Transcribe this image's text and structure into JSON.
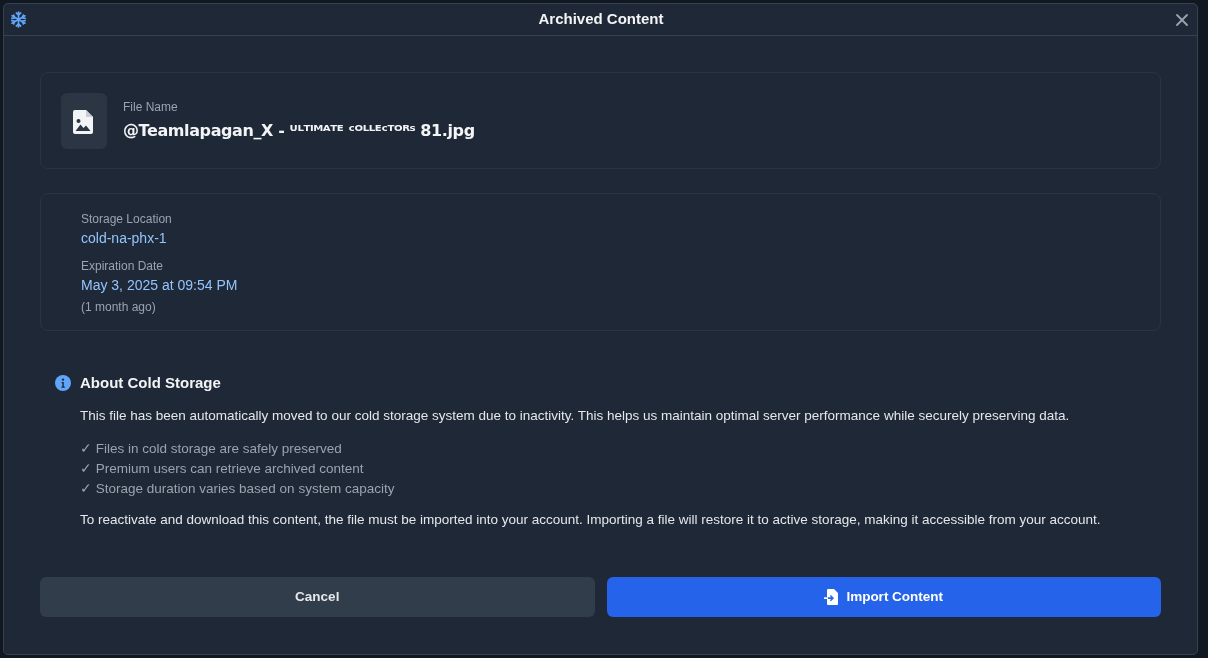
{
  "dialog": {
    "title": "Archived Content"
  },
  "file": {
    "label": "File Name",
    "name": "@Teamlapagan_X - ᵁᴸᵀᴵᴹᴬᵀᴱ ᶜᴼᴸᴸᴱᶜᵀᴼᴿˢ 81.jpg"
  },
  "details": [
    {
      "label": "Storage Location",
      "value": "cold-na-phx-1"
    },
    {
      "label": "Expiration Date",
      "value": "May 3, 2025 at 09:54 PM",
      "note": "(1 month ago)"
    }
  ],
  "about": {
    "title": "About Cold Storage",
    "intro": "This file has been automatically moved to our cold storage system due to inactivity. This helps us maintain optimal server performance while securely preserving data.",
    "points": [
      "✓ Files in cold storage are safely preserved",
      "✓ Premium users can retrieve archived content",
      "✓ Storage duration varies based on system capacity"
    ],
    "outro": "To reactivate and download this content, the file must be imported into your account. Importing a file will restore it to active storage, making it accessible from your account."
  },
  "buttons": [
    {
      "label": "Cancel",
      "kind": "secondary"
    },
    {
      "label": "Import Content",
      "kind": "primary"
    }
  ]
}
